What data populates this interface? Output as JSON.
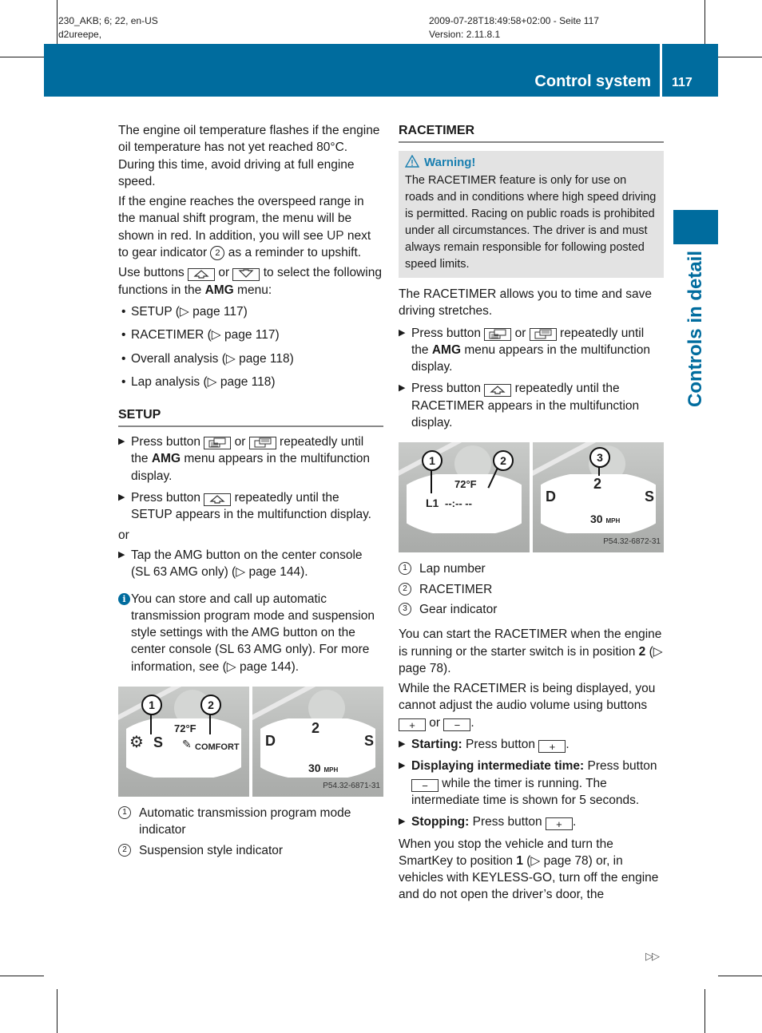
{
  "meta": {
    "doc_id": "230_AKB; 6; 22, en-US",
    "author": "d2ureepe,",
    "timestamp": "2009-07-28T18:49:58+02:00 - Seite 117",
    "version": "Version: 2.11.8.1"
  },
  "header": {
    "title": "Control system",
    "page_number": "117",
    "brand_color": "#006c9e"
  },
  "side_tab": {
    "label": "Controls in detail"
  },
  "left": {
    "intro_p1": "The engine oil temperature flashes if the engine oil temperature has not yet reached 80°C. During this time, avoid driving at full engine speed.",
    "intro_p2_a": "If the engine reaches the overspeed range in the manual shift program, the menu will be shown in red. In addition, you will see ",
    "intro_p2_up": "UP",
    "intro_p2_b": " next to gear indicator ",
    "intro_p2_ref": "2",
    "intro_p2_c": " as a reminder to upshift.",
    "use_a": "Use buttons ",
    "use_or": " or ",
    "use_b": " to select the following functions in the ",
    "use_amg": "AMG",
    "use_c": " menu:",
    "menu_items": [
      "SETUP (▷ page 117)",
      "RACETIMER (▷ page 117)",
      "Overall analysis (▷ page 118)",
      "Lap analysis (▷ page 118)"
    ],
    "setup_heading": "SETUP",
    "setup_step1_a": "Press button ",
    "setup_step1_or": " or ",
    "setup_step1_b": " repeatedly until the ",
    "setup_step1_amg": "AMG",
    "setup_step1_c": " menu appears in the multifunction display.",
    "setup_step2_a": "Press button ",
    "setup_step2_b": " repeatedly until the SETUP appears in the multifunction display.",
    "or_label": "or",
    "setup_step3": "Tap the AMG button on the center console (SL 63 AMG only) (▷ page 144).",
    "info_text": "You can store and call up automatic transmission program mode and suspension style settings with the AMG button on the center console (SL 63 AMG only). For more information, see (▷ page 144).",
    "figure": {
      "temp": "72°F",
      "mode": "S",
      "suspension": "COMFORT",
      "gear_left": "D",
      "gear": "2",
      "gear_right": "S",
      "speed": "30",
      "speed_unit": "MPH",
      "code": "P54.32-6871-31",
      "callouts": [
        "1",
        "2"
      ]
    },
    "legend": [
      {
        "num": "1",
        "text": "Automatic transmission program mode indicator"
      },
      {
        "num": "2",
        "text": "Suspension style indicator"
      }
    ]
  },
  "right": {
    "racetimer_heading": "RACETIMER",
    "warning_title": "Warning!",
    "warning_text": "The RACETIMER feature is only for use on roads and in conditions where high speed driving is permitted. Racing on public roads is prohibited under all circumstances. The driver is and must always remain responsible for following posted speed limits.",
    "intro": "The RACETIMER allows you to time and save driving stretches.",
    "step1_a": "Press button ",
    "step1_or": " or ",
    "step1_b": " repeatedly until the ",
    "step1_amg": "AMG",
    "step1_c": " menu appears in the multifunction display.",
    "step2_a": "Press button ",
    "step2_b": " repeatedly until the RACETIMER appears in the multifunction display.",
    "figure": {
      "temp": "72°F",
      "lap": "L1",
      "timer": "--:-- --",
      "gear_left": "D",
      "gear": "2",
      "gear_right": "S",
      "speed": "30",
      "speed_unit": "MPH",
      "code": "P54.32-6872-31",
      "callouts": [
        "1",
        "2",
        "3"
      ]
    },
    "legend": [
      {
        "num": "1",
        "text": "Lap number"
      },
      {
        "num": "2",
        "text": "RACETIMER"
      },
      {
        "num": "3",
        "text": "Gear indicator"
      }
    ],
    "start_p_a": "You can start the RACETIMER when the engine is running or the starter switch is in position ",
    "start_p_pos": "2",
    "start_p_b": " (▷ page 78).",
    "volume_p_a": "While the RACETIMER is being displayed, you cannot adjust the audio volume using buttons ",
    "volume_p_or": " or ",
    "volume_p_b": ".",
    "starting_label": "Starting:",
    "starting_text": " Press button ",
    "intermediate_label": "Displaying intermediate time:",
    "intermediate_a": " Press button ",
    "intermediate_b": " while the timer is running. The intermediate time is shown for 5 seconds.",
    "stopping_label": "Stopping:",
    "stopping_text": " Press button ",
    "final_a": "When you stop the vehicle and turn the SmartKey to position ",
    "final_pos": "1",
    "final_b": " (▷ page 78) or, in vehicles with KEYLESS-GO, turn off the engine and do not open the driver’s door, the"
  },
  "buttons": {
    "up": "⌂",
    "down": "▽",
    "plus": "+",
    "minus": "−",
    "period": "."
  },
  "continue_mark": "▷▷"
}
